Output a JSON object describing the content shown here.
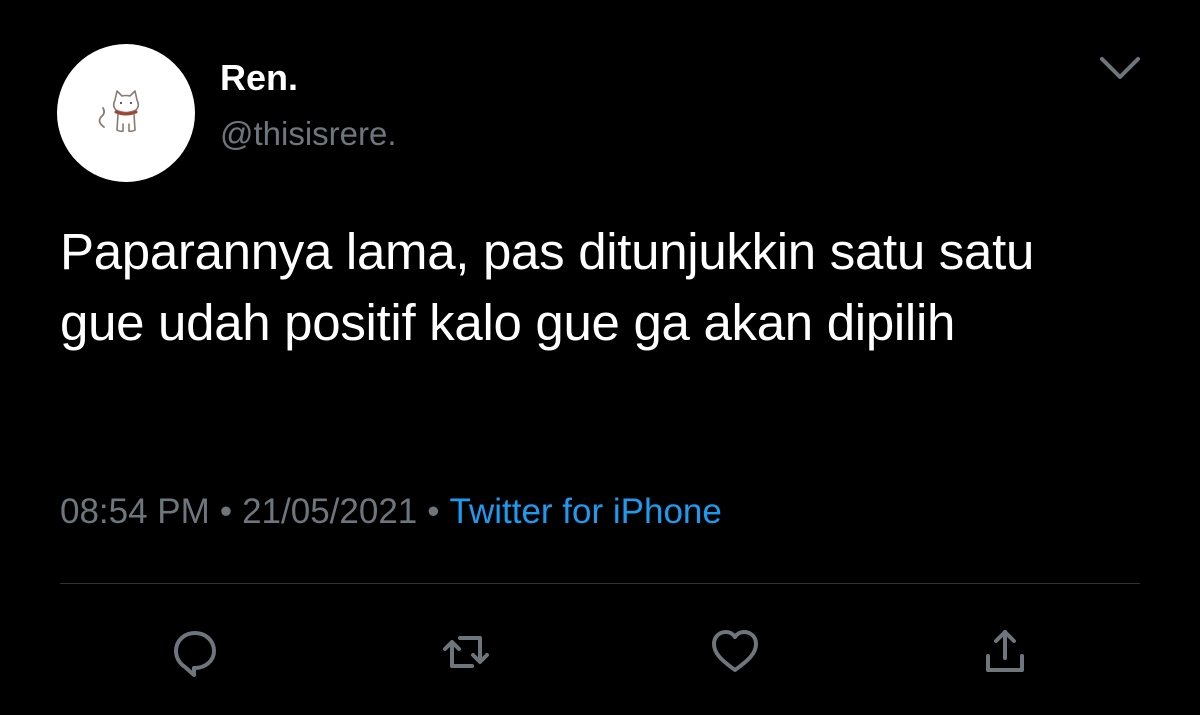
{
  "user": {
    "display_name": "Ren.",
    "handle": "@thisisrere."
  },
  "tweet": {
    "text": "Paparannya lama, pas ditunjukkin satu satu gue udah positif kalo gue ga akan dipilih",
    "time": "08:54 PM",
    "date": "21/05/2021",
    "separator": "•",
    "source": "Twitter for iPhone"
  },
  "actions": [
    "reply-icon",
    "retweet-icon",
    "like-icon",
    "share-icon"
  ],
  "colors": {
    "background": "#000000",
    "text": "#ffffff",
    "muted": "#6e767d",
    "link": "#1d9bf0",
    "divider": "#2f3336"
  }
}
